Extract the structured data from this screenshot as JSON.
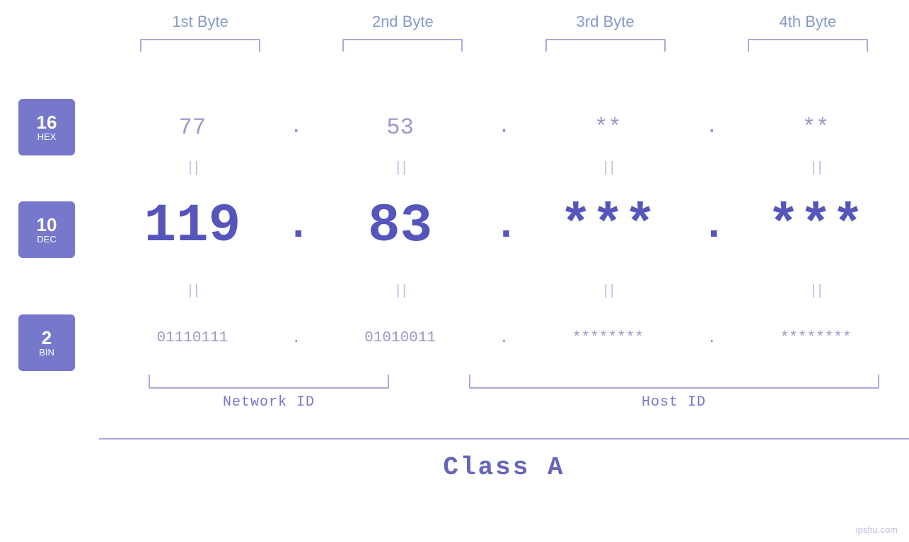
{
  "page": {
    "background": "#ffffff",
    "watermark": "ipshu.com"
  },
  "headers": {
    "byte1": "1st Byte",
    "byte2": "2nd Byte",
    "byte3": "3rd Byte",
    "byte4": "4th Byte"
  },
  "badges": {
    "hex": {
      "number": "16",
      "label": "HEX"
    },
    "dec": {
      "number": "10",
      "label": "DEC"
    },
    "bin": {
      "number": "2",
      "label": "BIN"
    }
  },
  "rows": {
    "hex": {
      "byte1": "77",
      "byte2": "53",
      "byte3": "**",
      "byte4": "**"
    },
    "dec": {
      "byte1": "119",
      "byte2": "83",
      "byte3": "***",
      "byte4": "***"
    },
    "bin": {
      "byte1": "01110111",
      "byte2": "01010011",
      "byte3": "********",
      "byte4": "********"
    }
  },
  "labels": {
    "network_id": "Network ID",
    "host_id": "Host ID",
    "class": "Class A"
  },
  "separators": {
    "dot": ".",
    "equals": "||"
  }
}
